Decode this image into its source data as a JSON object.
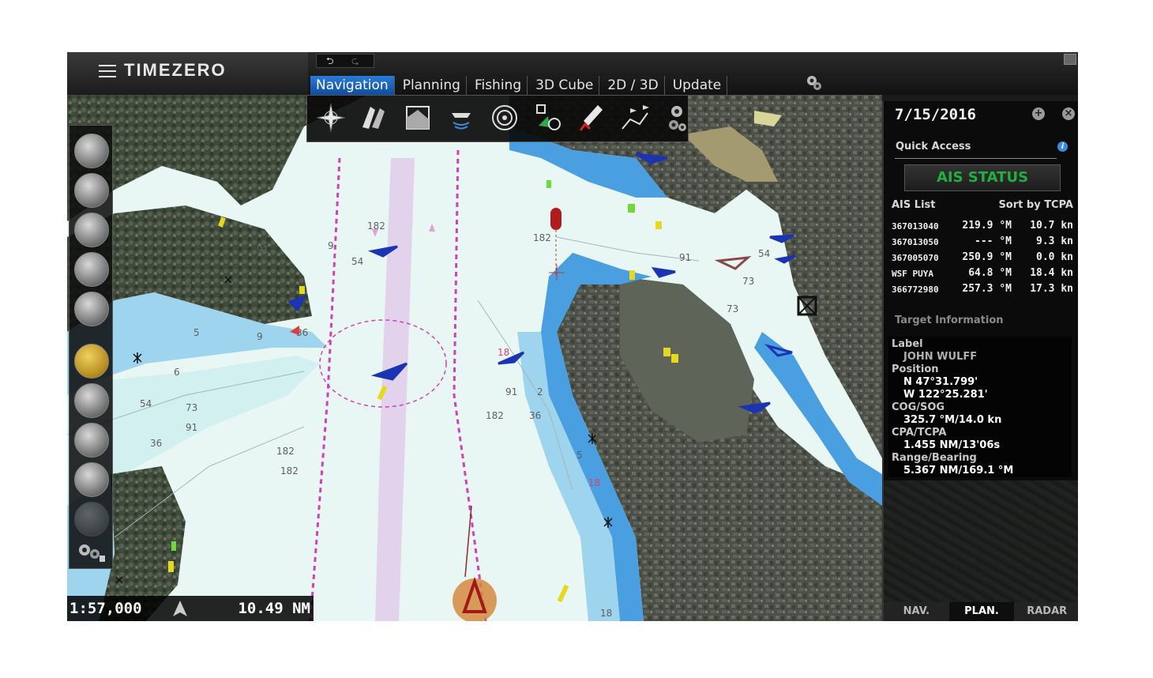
{
  "app": {
    "brand": "TIMEZERO",
    "tabs": [
      {
        "label": "Navigation",
        "active": true
      },
      {
        "label": "Planning",
        "active": false
      },
      {
        "label": "Fishing",
        "active": false
      },
      {
        "label": "3D Cube",
        "active": false
      },
      {
        "label": "2D / 3D",
        "active": false
      },
      {
        "label": "Update",
        "active": false
      }
    ],
    "undo_icon": "undo-icon",
    "redo_icon": "redo-icon",
    "settings_icon": "gear-icon"
  },
  "nav_toolbar": {
    "buttons": [
      {
        "name": "compass-rose-icon"
      },
      {
        "name": "chart-layers-icon"
      },
      {
        "name": "chart-overlay-icon"
      },
      {
        "name": "sonar-boat-icon"
      },
      {
        "name": "radar-target-icon"
      },
      {
        "name": "ais-target-icon"
      },
      {
        "name": "mob-marker-icon"
      },
      {
        "name": "route-flags-icon"
      },
      {
        "name": "toolbar-settings-icon"
      }
    ],
    "accent": "#2a7bd8"
  },
  "left_toolbar": {
    "buttons": [
      {
        "name": "boat-center-icon"
      },
      {
        "name": "boat-follow-icon"
      },
      {
        "name": "boat-offset-icon"
      },
      {
        "name": "zoom-in-icon"
      },
      {
        "name": "zoom-out-icon"
      },
      {
        "name": "pan-hand-icon",
        "selected": true
      },
      {
        "name": "divider-measure-icon"
      },
      {
        "name": "boat-route-icon"
      },
      {
        "name": "rotate-view-icon"
      },
      {
        "name": "radar-overlay-icon"
      }
    ],
    "settings_icon": "gear-lock-icon"
  },
  "map": {
    "scale": "1:57,000",
    "range": "10.49 NM",
    "depth_labels": [
      "182",
      "182",
      "182",
      "182",
      "182",
      "91",
      "91",
      "91",
      "91",
      "73",
      "73",
      "73",
      "54",
      "54",
      "54",
      "36",
      "36",
      "36",
      "18",
      "18",
      "18",
      "9",
      "9",
      "2",
      "5",
      "5",
      "6",
      "5",
      "1"
    ]
  },
  "panel": {
    "date": "7/15/2016",
    "quick_access_label": "Quick Access",
    "ais_status_label": "AIS STATUS",
    "ais_list_label": "AIS List",
    "sort_label": "Sort by TCPA",
    "ais_rows": [
      {
        "id": "367013040",
        "bearing": "219.9 °M",
        "range": "10.7 kn"
      },
      {
        "id": "367013050",
        "bearing": "--- °M",
        "range": "9.3 kn"
      },
      {
        "id": "367005070",
        "bearing": "250.9 °M",
        "range": "0.0 kn"
      },
      {
        "id": "WSF PUYA",
        "bearing": "64.8 °M",
        "range": "18.4 kn"
      },
      {
        "id": "366772980",
        "bearing": "257.3 °M",
        "range": "17.3 kn"
      }
    ],
    "target_info_label": "Target Information",
    "target": {
      "label_title": "Label",
      "label_value": "JOHN WULFF",
      "position_title": "Position",
      "lat": "N 47°31.799'",
      "lon": "W 122°25.281'",
      "cogsog_title": "COG/SOG",
      "cogsog": "325.7 °M/14.0 kn",
      "cpa_title": "CPA/TCPA",
      "cpa": "1.455 NM/13'06s",
      "rb_title": "Range/Bearing",
      "rb": "5.367 NM/169.1 °M"
    },
    "tabs": [
      {
        "label": "NAV.",
        "active": false
      },
      {
        "label": "PLAN.",
        "active": true
      },
      {
        "label": "RADAR",
        "active": false
      }
    ],
    "status_color": "#20b040"
  }
}
